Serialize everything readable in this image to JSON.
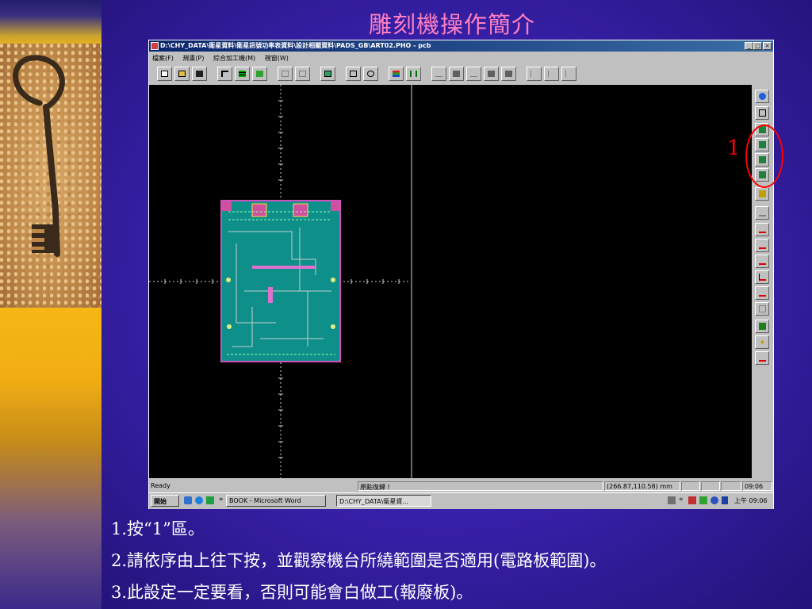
{
  "slide": {
    "title": "雕刻機操作簡介",
    "steps": [
      "1.按“1”區。",
      "2.請依序由上往下按，並觀察機台所繞範圍是否適用(電路板範圍)。",
      "3.此設定一定要看，否則可能會白做工(報廢板)。"
    ],
    "annotation_label": "1",
    "annotation_color": "#ff0000"
  },
  "window": {
    "title": "D:\\CHY_DATA\\衛星資料\\衛星訊號功率表資料\\設計相關資料\\PADS_GB\\ART02.PHO - pcb",
    "controls": [
      "_",
      "□",
      "×"
    ],
    "menu": [
      "檔案(F)",
      "規畫(P)",
      "綜合加工機(M)",
      "視窗(W)"
    ]
  },
  "toolbar": {
    "buttons": [
      "new-icon",
      "open-icon",
      "save-icon",
      "undo-icon",
      "layers-icon",
      "grid-icon",
      "frame-icon",
      "frame2-icon",
      "calculator-icon",
      "zoom-fit-icon",
      "zoom-icon",
      "layer-color-icon",
      "measure-icon",
      "tool1-icon",
      "tool2-icon",
      "tool3-icon",
      "tool4-icon",
      "tool5-icon",
      "tool6-icon",
      "tool7-icon",
      "tool8-icon"
    ]
  },
  "right_toolbar": {
    "buttons": [
      "home-icon",
      "origin-icon",
      "area1-icon",
      "area2-icon",
      "area3-icon",
      "area4-icon",
      "drill-icon",
      "z-up-icon",
      "z-down-1-icon",
      "z-down-2-icon",
      "z-down-3-icon",
      "z-down-4-icon",
      "z-down-5-icon",
      "spindle-icon",
      "probe-icon",
      "move-icon",
      "stop-icon"
    ]
  },
  "status": {
    "ready": "Ready",
    "message": "原點復歸 !",
    "coords": "(266.87,110.58) mm",
    "time_field": "09:06"
  },
  "taskbar": {
    "start": "開始",
    "tasks": [
      "BOOK - Microsoft Word",
      "D:\\CHY_DATA\\衛星資..."
    ],
    "clock": "上午 09:06"
  },
  "colors": {
    "slide_title": "#ff7fc2",
    "pcb_board": "#0f8f8a",
    "pcb_border": "#d050c0",
    "canvas": "#000000"
  }
}
